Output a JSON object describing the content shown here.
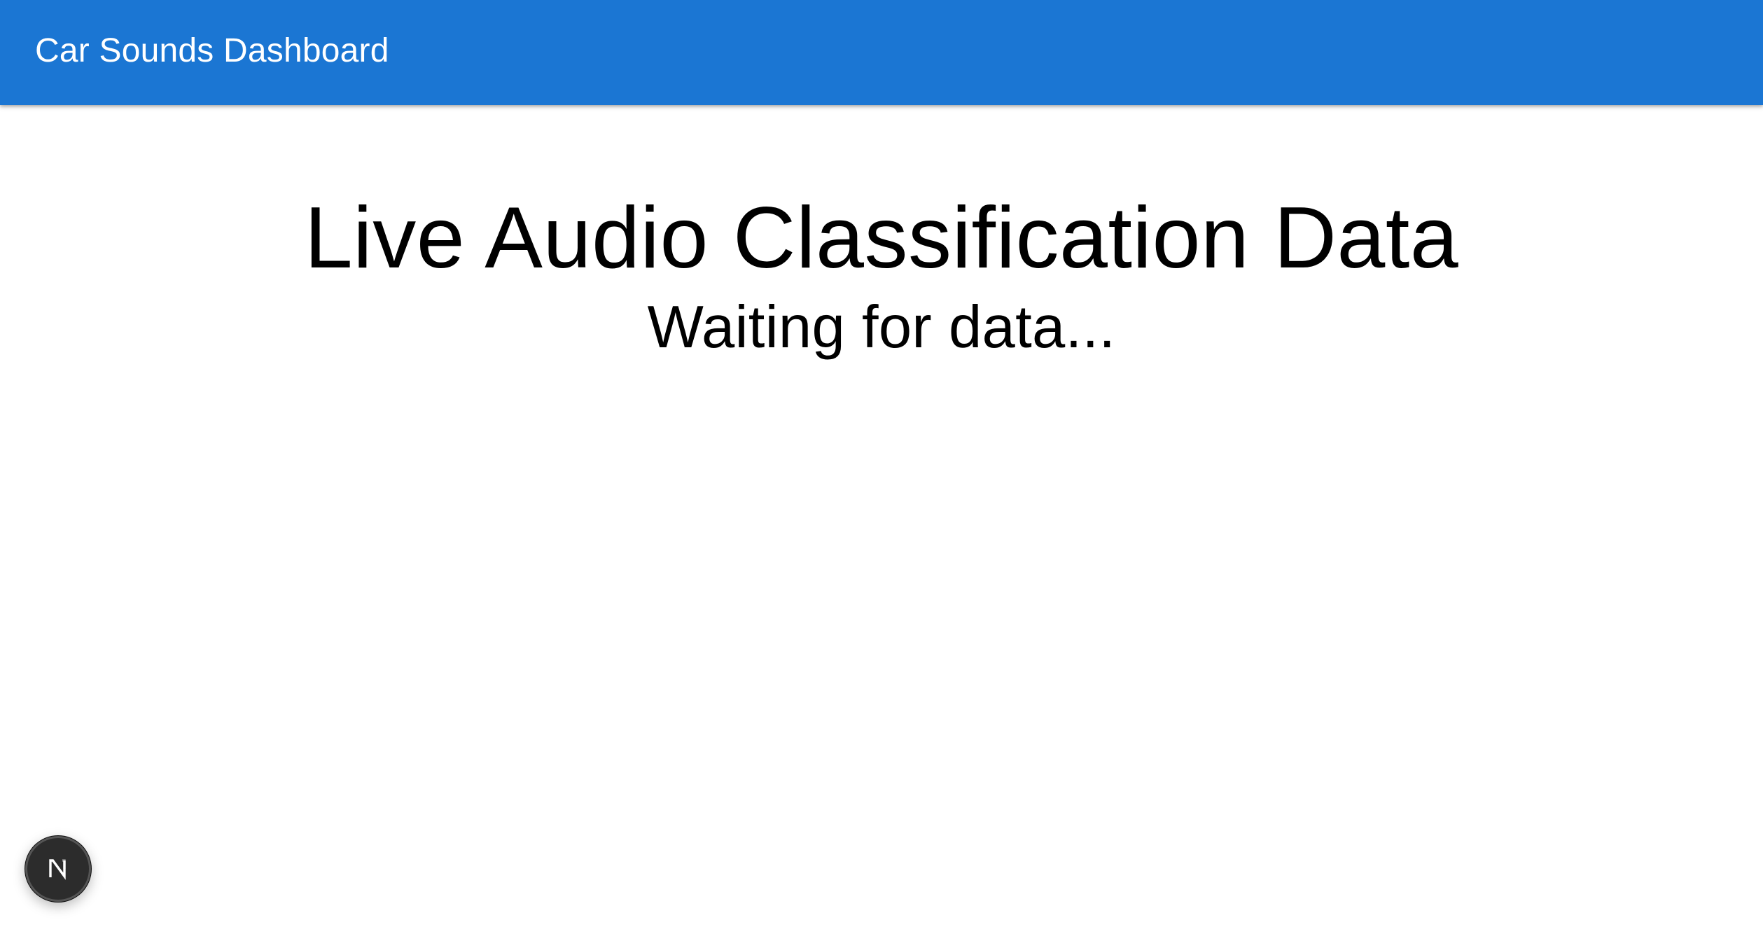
{
  "app_bar": {
    "title": "Car Sounds Dashboard",
    "background_color": "#1b76d3"
  },
  "main": {
    "heading": "Live Audio Classification Data",
    "status_text": "Waiting for data..."
  },
  "dev_indicator": {
    "icon": "nextjs-n-logo-icon",
    "background_color": "#2c2c2c"
  }
}
